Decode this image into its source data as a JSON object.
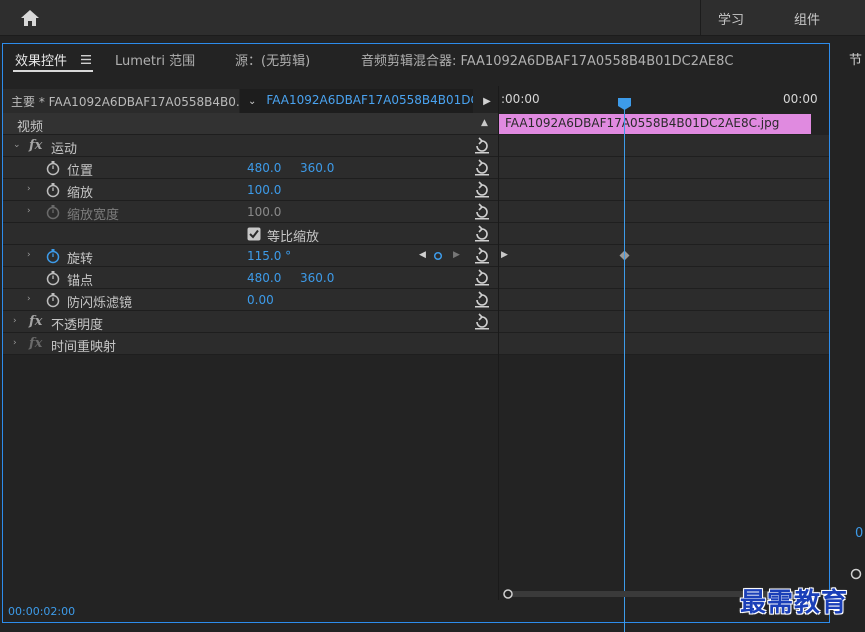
{
  "header": {
    "workspaces": [
      "学习",
      "组件"
    ]
  },
  "panel": {
    "tabs": [
      {
        "label": "效果控件",
        "active": true
      },
      {
        "label": "Lumetri 范围",
        "active": false
      },
      {
        "label": "源：(无剪辑)",
        "active": false
      },
      {
        "label": "音频剪辑混合器: FAA1092A6DBAF17A0558B4B01DC2AE8C",
        "active": false
      }
    ],
    "tab_menu_icon": "hamburger-icon"
  },
  "source": {
    "main": "主要 * FAA1092A6DBAF17A0558B4B0...",
    "clip": "FAA1092A6DBAF17A0558B4B01DC..."
  },
  "effects": {
    "video_header": "视频",
    "rows": [
      {
        "type": "group",
        "fx": "fx",
        "label": "运动",
        "expanded": true
      },
      {
        "type": "prop",
        "label": "位置",
        "values": [
          "480.0",
          "360.0"
        ],
        "expandable": false
      },
      {
        "type": "prop",
        "label": "缩放",
        "values": [
          "100.0"
        ],
        "expandable": true
      },
      {
        "type": "prop",
        "label": "缩放宽度",
        "values": [
          "100.0"
        ],
        "expandable": true,
        "disabled": true
      },
      {
        "type": "checkbox",
        "label": "等比缩放",
        "checked": true
      },
      {
        "type": "prop",
        "label": "旋转",
        "values": [
          "115.0 °"
        ],
        "expandable": true,
        "animated": true
      },
      {
        "type": "prop",
        "label": "锚点",
        "values": [
          "480.0",
          "360.0"
        ],
        "expandable": false
      },
      {
        "type": "prop",
        "label": "防闪烁滤镜",
        "values": [
          "0.00"
        ],
        "expandable": true
      },
      {
        "type": "group",
        "fx": "fx",
        "label": "不透明度",
        "expanded": false
      },
      {
        "type": "group",
        "fx": "fx",
        "label": "时间重映射",
        "expanded": false,
        "disabled": true
      }
    ]
  },
  "timeline": {
    "start": ":00:00",
    "end": "00:00",
    "clip_name": "FAA1092A6DBAF17A0558B4B01DC2AE8C.jpg",
    "clip_color": "#e08ae0"
  },
  "status": {
    "current_time": "00:00:02:00"
  },
  "side": {
    "label": "节",
    "value": "0"
  },
  "watermark": "最需教育",
  "colors": {
    "accent": "#3d9be9",
    "panel_border": "#2d8ceb"
  }
}
